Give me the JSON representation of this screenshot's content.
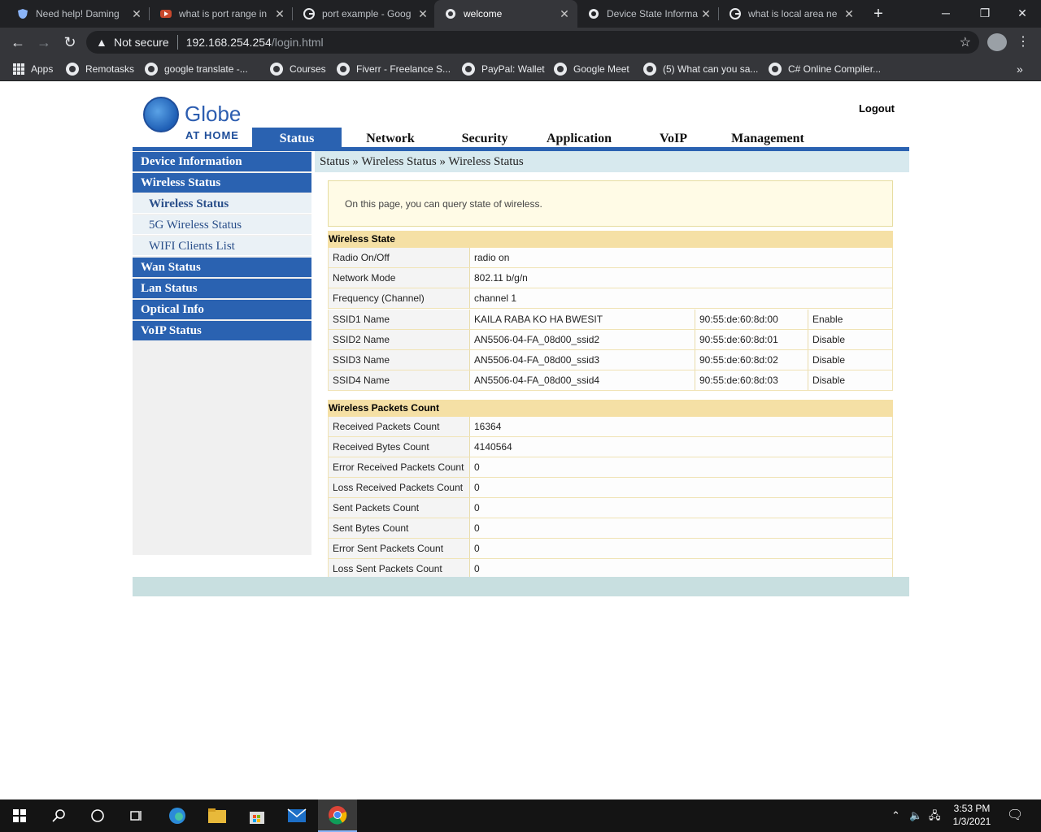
{
  "browser": {
    "tabs": [
      {
        "title": "Need help! Daming",
        "icon": "shield-icon"
      },
      {
        "title": "what is port range in",
        "icon": "youtube-icon"
      },
      {
        "title": "port example - Goog",
        "icon": "google-icon"
      },
      {
        "title": "welcome",
        "icon": "globe-icon",
        "active": true
      },
      {
        "title": "Device State Informa",
        "icon": "globe-icon"
      },
      {
        "title": "what is local area ne",
        "icon": "google-icon"
      }
    ],
    "address": {
      "security_label": "Not secure",
      "host": "192.168.254.254",
      "path": "/login.html"
    },
    "bookmarks": [
      "Apps",
      "Remotasks",
      "google translate -...",
      "Courses",
      "Fiverr - Freelance S...",
      "PayPal: Wallet",
      "Google Meet",
      "(5) What can you sa...",
      "C# Online Compiler..."
    ],
    "more_bookmarks": "»"
  },
  "router": {
    "brand": "Globe",
    "brand_sub": "AT HOME",
    "logout": "Logout",
    "nav": [
      "Status",
      "Network",
      "Security",
      "Application",
      "VoIP",
      "Management"
    ],
    "sidebar": {
      "items": [
        "Device Information",
        "Wireless Status",
        "Wan Status",
        "Lan Status",
        "Optical Info",
        "VoIP Status"
      ],
      "subitems": [
        "Wireless Status",
        "5G Wireless Status",
        "WIFI Clients List"
      ]
    },
    "breadcrumb": "Status » Wireless Status » Wireless Status",
    "info": "On this page, you can query state of wireless.",
    "wireless_state": {
      "title": "Wireless State",
      "rows": [
        {
          "label": "Radio On/Off",
          "value": "radio on"
        },
        {
          "label": "Network Mode",
          "value": "802.11 b/g/n"
        },
        {
          "label": "Frequency (Channel)",
          "value": "channel 1"
        }
      ],
      "ssids": [
        {
          "label": "SSID1 Name",
          "value": "KAILA RABA KO HA BWESIT",
          "mac": "90:55:de:60:8d:00",
          "status": "Enable"
        },
        {
          "label": "SSID2 Name",
          "value": "AN5506-04-FA_08d00_ssid2",
          "mac": "90:55:de:60:8d:01",
          "status": "Disable"
        },
        {
          "label": "SSID3 Name",
          "value": "AN5506-04-FA_08d00_ssid3",
          "mac": "90:55:de:60:8d:02",
          "status": "Disable"
        },
        {
          "label": "SSID4 Name",
          "value": "AN5506-04-FA_08d00_ssid4",
          "mac": "90:55:de:60:8d:03",
          "status": "Disable"
        }
      ]
    },
    "packets": {
      "title": "Wireless Packets Count",
      "rows": [
        {
          "label": "Received Packets Count",
          "value": "16364"
        },
        {
          "label": "Received Bytes Count",
          "value": "4140564"
        },
        {
          "label": "Error Received Packets Count",
          "value": "0"
        },
        {
          "label": "Loss Received Packets Count",
          "value": "0"
        },
        {
          "label": "Sent Packets Count",
          "value": "0"
        },
        {
          "label": "Sent Bytes Count",
          "value": "0"
        },
        {
          "label": "Error Sent Packets Count",
          "value": "0"
        },
        {
          "label": "Loss Sent Packets Count",
          "value": "0"
        }
      ]
    }
  },
  "taskbar": {
    "time": "3:53 PM",
    "date": "1/3/2021"
  },
  "colors": {
    "nav_blue": "#2a62b1",
    "section_header": "#f5e0a5",
    "breadcrumb_bg": "#d7e9ee"
  }
}
